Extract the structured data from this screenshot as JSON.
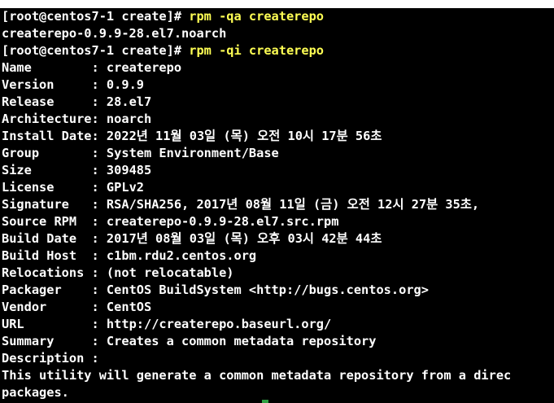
{
  "terminal": {
    "colors": {
      "background": "#000000",
      "text": "#ffffff",
      "command": "#ffff54"
    },
    "prompt_1": "[root@centos7-1 create]# ",
    "command_1": "rpm -qa createrepo",
    "output_1": "createrepo-0.9.9-28.el7.noarch",
    "prompt_2": "[root@centos7-1 create]# ",
    "command_2": "rpm -qi createrepo",
    "info": [
      {
        "label": "Name        ",
        "value": ": createrepo"
      },
      {
        "label": "Version     ",
        "value": ": 0.9.9"
      },
      {
        "label": "Release     ",
        "value": ": 28.el7"
      },
      {
        "label": "Architecture",
        "value": ": noarch"
      },
      {
        "label": "Install Date",
        "value": ": 2022년 11월 03일 (목) 오전 10시 17분 56초"
      },
      {
        "label": "Group       ",
        "value": ": System Environment/Base"
      },
      {
        "label": "Size        ",
        "value": ": 309485"
      },
      {
        "label": "License     ",
        "value": ": GPLv2"
      },
      {
        "label": "Signature   ",
        "value": ": RSA/SHA256, 2017년 08월 11일 (금) 오전 12시 27분 35초,"
      },
      {
        "label": "Source RPM  ",
        "value": ": createrepo-0.9.9-28.el7.src.rpm"
      },
      {
        "label": "Build Date  ",
        "value": ": 2017년 08월 03일 (목) 오후 03시 42분 44초"
      },
      {
        "label": "Build Host  ",
        "value": ": c1bm.rdu2.centos.org"
      },
      {
        "label": "Relocations ",
        "value": ": (not relocatable)"
      },
      {
        "label": "Packager    ",
        "value": ": CentOS BuildSystem <http://bugs.centos.org>"
      },
      {
        "label": "Vendor      ",
        "value": ": CentOS"
      },
      {
        "label": "URL         ",
        "value": ": http://createrepo.baseurl.org/"
      },
      {
        "label": "Summary     ",
        "value": ": Creates a common metadata repository"
      },
      {
        "label": "Description ",
        "value": ":"
      }
    ],
    "description_1": "This utility will generate a common metadata repository from a direc",
    "description_2": "packages."
  }
}
